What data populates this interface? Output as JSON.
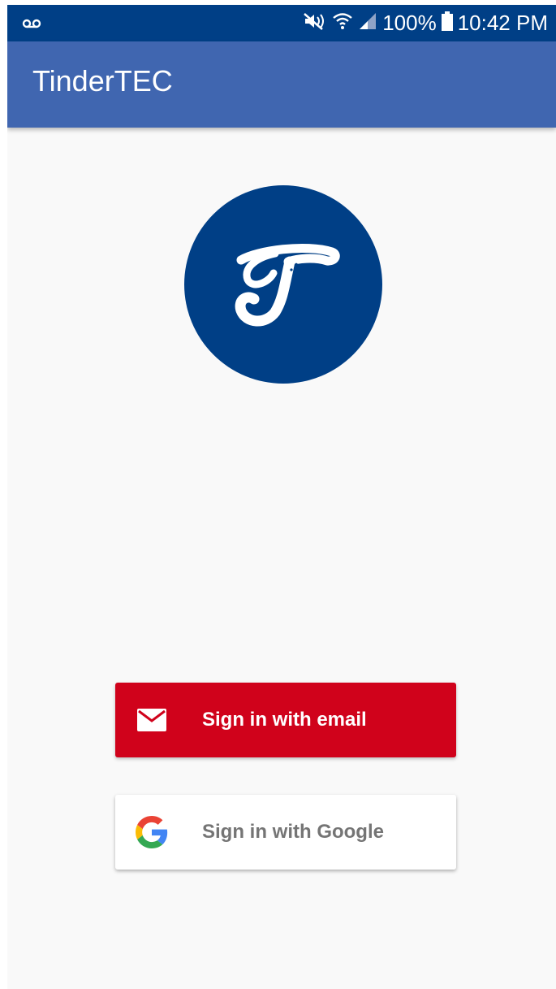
{
  "status_bar": {
    "left_icon": "voicemail-icon",
    "icons": [
      "mute-icon",
      "wifi-icon",
      "signal-icon"
    ],
    "battery_text": "100%",
    "battery_icon": "battery-icon",
    "time": "10:42 PM",
    "background_color": "#003f86"
  },
  "app_bar": {
    "title": "TinderTEC",
    "background_color": "#4066b0"
  },
  "logo": {
    "letter": "T",
    "background_color": "#003f86"
  },
  "buttons": {
    "email": {
      "label": "Sign in with email",
      "icon": "mail-icon",
      "background_color": "#d0021b"
    },
    "google": {
      "label": "Sign in with Google",
      "icon": "google-icon",
      "background_color": "#ffffff"
    }
  }
}
